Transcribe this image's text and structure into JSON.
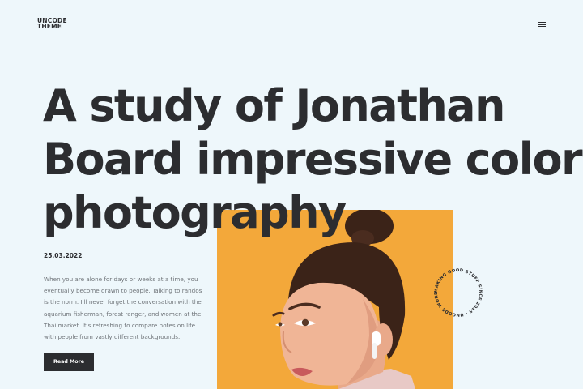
{
  "header": {
    "logo_line1": "UNCODE",
    "logo_line2": "THEME",
    "menu_icon": "hamburger-icon"
  },
  "hero": {
    "title_line1": "A study of Jonathan",
    "title_line2": "Board impressive colors",
    "title_line3": "photography"
  },
  "post": {
    "date": "25.03.2022",
    "excerpt_lines": [
      "When you are alone for days or weeks at a time, you",
      "eventually become drawn to people. Talking to randos",
      "is the norm. I'll never forget the conversation with the",
      "aquarium fisherman, forest ranger, and women at the",
      "Thai market. It's refreshing to compare notes on life",
      "with people from vastly different backgrounds."
    ],
    "read_more_label": "Read More"
  },
  "badge": {
    "circular_text": "MAKING GOOD STUFF SINCE 2015 · UNCODE WORDPRESS THEME · "
  },
  "colors": {
    "background": "#eef7fb",
    "text": "#2c2d30",
    "photo_backdrop": "#f3a83a",
    "button": "#2c2d30"
  }
}
